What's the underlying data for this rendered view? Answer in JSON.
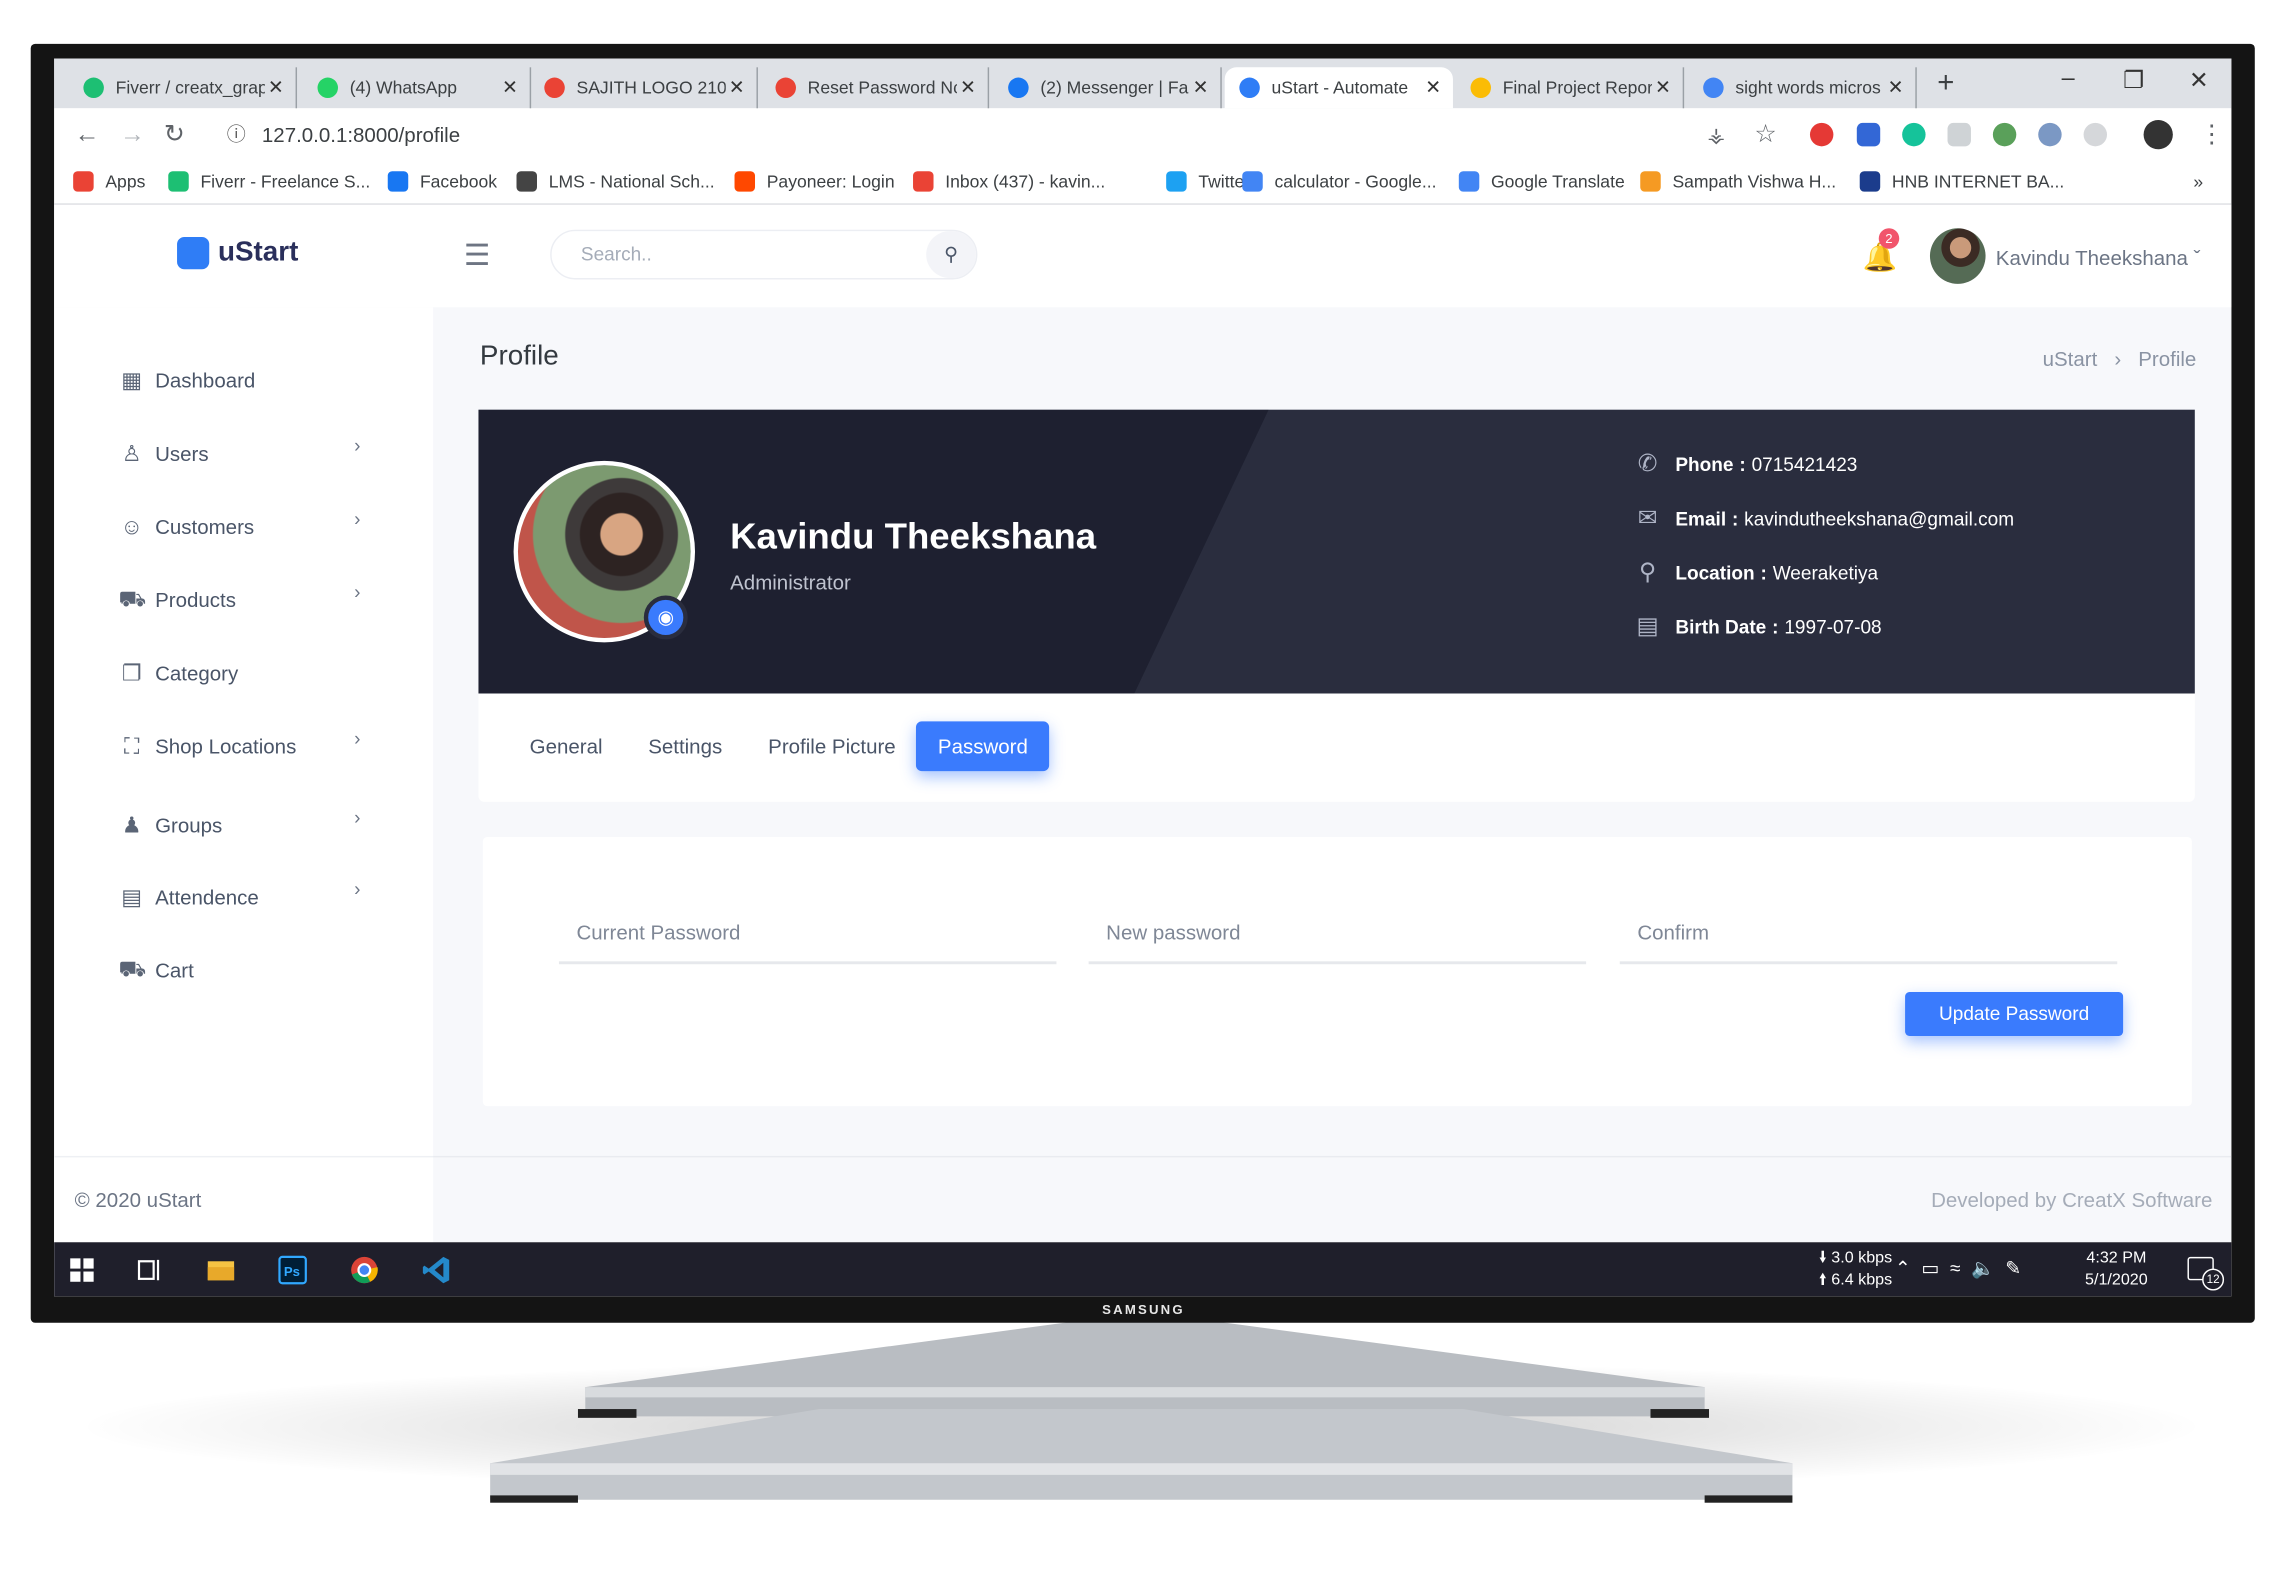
{
  "browser": {
    "tabs": [
      {
        "title": "Fiverr / creatx_grap",
        "color": "#1dbf73"
      },
      {
        "title": "(4) WhatsApp",
        "color": "#25d366"
      },
      {
        "title": "SAJITH LOGO 210",
        "color": "#ea4335"
      },
      {
        "title": "Reset Password Nc",
        "color": "#ea4335"
      },
      {
        "title": "(2) Messenger | Fa",
        "color": "#1877f2"
      },
      {
        "title": "uStart - Automate",
        "color": "#2f7df6"
      },
      {
        "title": "Final Project Repor",
        "color": "#fbbc05"
      },
      {
        "title": "sight words micros",
        "color": "#4285f4"
      }
    ],
    "url": "127.0.0.1:8000/profile",
    "bookmarks": [
      {
        "label": "Apps",
        "color": "#ea4335"
      },
      {
        "label": "Fiverr - Freelance S...",
        "color": "#1dbf73"
      },
      {
        "label": "Facebook",
        "color": "#1877f2"
      },
      {
        "label": "LMS - National Sch...",
        "color": "#444444"
      },
      {
        "label": "Payoneer: Login",
        "color": "#ff4800"
      },
      {
        "label": "Inbox (437) - kavin...",
        "color": "#ea4335"
      },
      {
        "label": "Twitter",
        "color": "#1da1f2"
      },
      {
        "label": "calculator - Google...",
        "color": "#4285f4"
      },
      {
        "label": "Google Translate",
        "color": "#4285f4"
      },
      {
        "label": "Sampath Vishwa H...",
        "color": "#f59a23"
      },
      {
        "label": "HNB INTERNET BA...",
        "color": "#1b3c8c"
      }
    ]
  },
  "app": {
    "brand": "uStart",
    "search_placeholder": "Search..",
    "notification_count": "2",
    "user_name": "Kavindu Theekshana",
    "sidebar": [
      {
        "label": "Dashboard",
        "icon": "grid-icon",
        "chevron": false
      },
      {
        "label": "Users",
        "icon": "user-icon",
        "chevron": true
      },
      {
        "label": "Customers",
        "icon": "smile-icon",
        "chevron": true
      },
      {
        "label": "Products",
        "icon": "cart-icon",
        "chevron": true
      },
      {
        "label": "Category",
        "icon": "copy-icon",
        "chevron": false
      },
      {
        "label": "Shop Locations",
        "icon": "map-icon",
        "chevron": true
      },
      {
        "label": "Groups",
        "icon": "users-icon",
        "chevron": true
      },
      {
        "label": "Attendence",
        "icon": "id-card-icon",
        "chevron": true
      },
      {
        "label": "Cart",
        "icon": "cart-icon",
        "chevron": false
      }
    ],
    "page_title": "Profile",
    "breadcrumb": {
      "root": "uStart",
      "current": "Profile"
    },
    "profile": {
      "name": "Kavindu Theekshana",
      "role": "Administrator",
      "phone_label": "Phone",
      "phone": "0715421423",
      "email_label": "Email",
      "email": "kavindutheekshana@gmail.com",
      "location_label": "Location",
      "location": "Weeraketiya",
      "birth_label": "Birth Date",
      "birth": "1997-07-08"
    },
    "tabs": [
      "General",
      "Settings",
      "Profile Picture",
      "Password"
    ],
    "active_tab": "Password",
    "password_form": {
      "current_placeholder": "Current Password",
      "new_placeholder": "New password",
      "confirm_placeholder": "Confirm",
      "submit_label": "Update Password"
    },
    "footer_left": "© 2020 uStart",
    "footer_right": "Developed by CreatX Software",
    "accent": "#3a7bfd"
  },
  "taskbar": {
    "download": "3.0 kbps",
    "upload": "6.4 kbps",
    "time": "4:32 PM",
    "date": "5/1/2020",
    "notifications": "12"
  },
  "monitor_brand": "SAMSUNG"
}
